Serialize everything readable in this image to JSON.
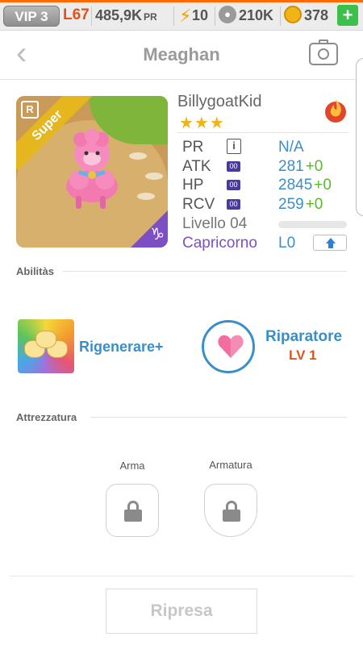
{
  "status_bar": {
    "vip": "VIP 3",
    "level": "L67",
    "pr": "485,9K",
    "pr_unit": "PR",
    "energy": "10",
    "paw_currency": "210K",
    "gold": "378",
    "add_label": "+"
  },
  "header": {
    "title": "Meaghan"
  },
  "pet_card": {
    "rarity": "Super",
    "rank_tag": "R",
    "zodiac_glyph": "♑"
  },
  "stats": {
    "owner": "BillygoatKid",
    "stars": "★★★",
    "pr_label": "PR",
    "pr_value": "N/A",
    "atk_label": "ATK",
    "atk_value": "281",
    "atk_bonus": "+0",
    "hp_label": "HP",
    "hp_value": "2845",
    "hp_bonus": "+0",
    "rcv_label": "RCV",
    "rcv_value": "259",
    "rcv_bonus": "+0",
    "badge": "00",
    "level_label": "Livello 04",
    "level_progress": 0,
    "zodiac_name": "Capricorno",
    "zodiac_level": "L0"
  },
  "abilities": {
    "section_title": "Abilitàs",
    "items": [
      {
        "name": "Rigenerare+"
      },
      {
        "name": "Riparatore",
        "level": "LV 1"
      }
    ]
  },
  "equipment": {
    "section_title": "Attrezzatura",
    "weapon_label": "Arma",
    "armor_label": "Armatura"
  },
  "footer": {
    "resume_label": "Ripresa"
  },
  "colors": {
    "accent": "#3a8fc9",
    "bonus": "#5ab82a",
    "zodiac": "#7d4fc4",
    "level": "#e2531c"
  }
}
